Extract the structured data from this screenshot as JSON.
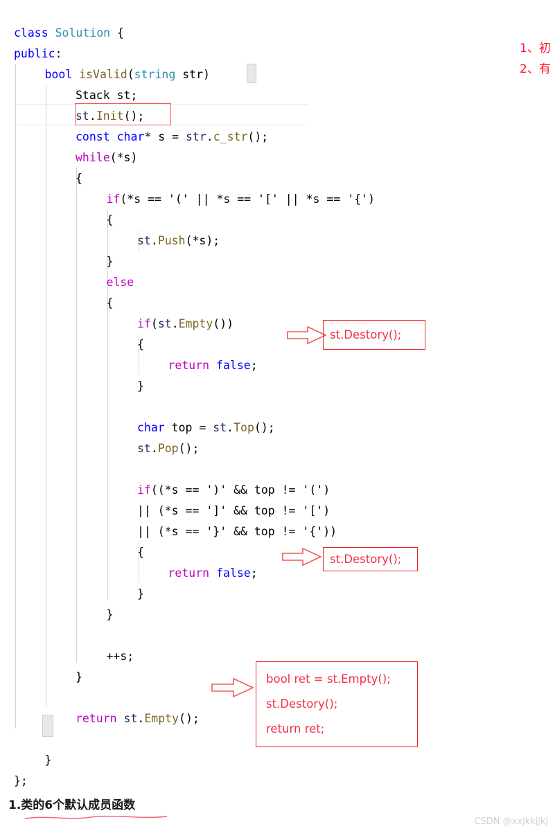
{
  "editor": {
    "language": "cpp",
    "background": "#ffffff",
    "current_line_number": 5,
    "colors": {
      "keyword": "#0000ff",
      "control": "#c000c0",
      "type": "#2b91af",
      "identifier": "#1f2d5e",
      "function": "#7a6420",
      "plain": "#000000",
      "annotation_red": "#f0304a",
      "box_red": "#ee2222"
    },
    "lines": [
      {
        "indent": 0,
        "tokens": [
          {
            "t": "class",
            "c": "kw"
          },
          {
            "t": " ",
            "c": "punc"
          },
          {
            "t": "Solution",
            "c": "type"
          },
          {
            "t": " {",
            "c": "punc"
          }
        ]
      },
      {
        "indent": 0,
        "tokens": [
          {
            "t": "public",
            "c": "kw"
          },
          {
            "t": ":",
            "c": "punc"
          }
        ]
      },
      {
        "indent": 1,
        "tokens": [
          {
            "t": "bool",
            "c": "kw"
          },
          {
            "t": " ",
            "c": "punc"
          },
          {
            "t": "isValid",
            "c": "fn"
          },
          {
            "t": "(",
            "c": "punc"
          },
          {
            "t": "string",
            "c": "type"
          },
          {
            "t": " str) ",
            "c": "punc"
          }
        ]
      },
      {
        "indent": 2,
        "tokens": [
          {
            "t": "Stack st;",
            "c": "punc"
          }
        ]
      },
      {
        "indent": 2,
        "tokens": [
          {
            "t": "st",
            "c": "ident"
          },
          {
            "t": ".",
            "c": "punc"
          },
          {
            "t": "Init",
            "c": "fn"
          },
          {
            "t": "();",
            "c": "punc"
          }
        ]
      },
      {
        "indent": 2,
        "tokens": [
          {
            "t": "const",
            "c": "kw"
          },
          {
            "t": " ",
            "c": "punc"
          },
          {
            "t": "char",
            "c": "kw"
          },
          {
            "t": "* s = ",
            "c": "punc"
          },
          {
            "t": "str",
            "c": "ident"
          },
          {
            "t": ".",
            "c": "punc"
          },
          {
            "t": "c_str",
            "c": "fn"
          },
          {
            "t": "();",
            "c": "punc"
          }
        ]
      },
      {
        "indent": 2,
        "tokens": [
          {
            "t": "while",
            "c": "ctl"
          },
          {
            "t": "(*s)",
            "c": "punc"
          }
        ]
      },
      {
        "indent": 2,
        "tokens": [
          {
            "t": "{",
            "c": "punc"
          }
        ]
      },
      {
        "indent": 3,
        "tokens": [
          {
            "t": "if",
            "c": "ctl"
          },
          {
            "t": "(*s == '(' || *s == '[' || *s == '{')",
            "c": "punc"
          }
        ]
      },
      {
        "indent": 3,
        "tokens": [
          {
            "t": "{",
            "c": "punc"
          }
        ]
      },
      {
        "indent": 4,
        "tokens": [
          {
            "t": "st",
            "c": "ident"
          },
          {
            "t": ".",
            "c": "punc"
          },
          {
            "t": "Push",
            "c": "fn"
          },
          {
            "t": "(*s);",
            "c": "punc"
          }
        ]
      },
      {
        "indent": 3,
        "tokens": [
          {
            "t": "}",
            "c": "punc"
          }
        ]
      },
      {
        "indent": 3,
        "tokens": [
          {
            "t": "else",
            "c": "ctl"
          }
        ]
      },
      {
        "indent": 3,
        "tokens": [
          {
            "t": "{",
            "c": "punc"
          }
        ]
      },
      {
        "indent": 4,
        "tokens": [
          {
            "t": "if",
            "c": "ctl"
          },
          {
            "t": "(",
            "c": "punc"
          },
          {
            "t": "st",
            "c": "ident"
          },
          {
            "t": ".",
            "c": "punc"
          },
          {
            "t": "Empty",
            "c": "fn"
          },
          {
            "t": "())",
            "c": "punc"
          }
        ]
      },
      {
        "indent": 4,
        "tokens": [
          {
            "t": "{",
            "c": "punc"
          }
        ]
      },
      {
        "indent": 5,
        "tokens": [
          {
            "t": "return",
            "c": "ctl"
          },
          {
            "t": " ",
            "c": "punc"
          },
          {
            "t": "false",
            "c": "kw"
          },
          {
            "t": ";",
            "c": "punc"
          }
        ]
      },
      {
        "indent": 4,
        "tokens": [
          {
            "t": "}",
            "c": "punc"
          }
        ]
      },
      {
        "indent": 0,
        "tokens": []
      },
      {
        "indent": 4,
        "tokens": [
          {
            "t": "char",
            "c": "kw"
          },
          {
            "t": " top = ",
            "c": "punc"
          },
          {
            "t": "st",
            "c": "ident"
          },
          {
            "t": ".",
            "c": "punc"
          },
          {
            "t": "Top",
            "c": "fn"
          },
          {
            "t": "();",
            "c": "punc"
          }
        ]
      },
      {
        "indent": 4,
        "tokens": [
          {
            "t": "st",
            "c": "ident"
          },
          {
            "t": ".",
            "c": "punc"
          },
          {
            "t": "Pop",
            "c": "fn"
          },
          {
            "t": "();",
            "c": "punc"
          }
        ]
      },
      {
        "indent": 0,
        "tokens": []
      },
      {
        "indent": 4,
        "tokens": [
          {
            "t": "if",
            "c": "ctl"
          },
          {
            "t": "((*s == ')' && top != '(')",
            "c": "punc"
          }
        ]
      },
      {
        "indent": 4,
        "tokens": [
          {
            "t": "|| (*s == ']' && top != '[')",
            "c": "punc"
          }
        ]
      },
      {
        "indent": 4,
        "tokens": [
          {
            "t": "|| (*s == '}' && top != '{'))",
            "c": "punc"
          }
        ]
      },
      {
        "indent": 4,
        "tokens": [
          {
            "t": "{",
            "c": "punc"
          }
        ]
      },
      {
        "indent": 5,
        "tokens": [
          {
            "t": "return",
            "c": "ctl"
          },
          {
            "t": " ",
            "c": "punc"
          },
          {
            "t": "false",
            "c": "kw"
          },
          {
            "t": ";",
            "c": "punc"
          }
        ]
      },
      {
        "indent": 4,
        "tokens": [
          {
            "t": "}",
            "c": "punc"
          }
        ]
      },
      {
        "indent": 3,
        "tokens": [
          {
            "t": "}",
            "c": "punc"
          }
        ]
      },
      {
        "indent": 0,
        "tokens": []
      },
      {
        "indent": 3,
        "tokens": [
          {
            "t": "++s;",
            "c": "punc"
          }
        ]
      },
      {
        "indent": 2,
        "tokens": [
          {
            "t": "}",
            "c": "punc"
          }
        ]
      },
      {
        "indent": 0,
        "tokens": []
      },
      {
        "indent": 2,
        "tokens": [
          {
            "t": "return",
            "c": "ctl"
          },
          {
            "t": " ",
            "c": "punc"
          },
          {
            "t": "st",
            "c": "ident"
          },
          {
            "t": ".",
            "c": "punc"
          },
          {
            "t": "Empty",
            "c": "fn"
          },
          {
            "t": "();",
            "c": "punc"
          }
        ]
      },
      {
        "indent": 0,
        "tokens": []
      },
      {
        "indent": 1,
        "tokens": [
          {
            "t": "}",
            "c": "punc"
          }
        ]
      },
      {
        "indent": 0,
        "tokens": [
          {
            "t": "};",
            "c": "punc"
          }
        ]
      }
    ]
  },
  "annotations": {
    "note1": "st.Destory();",
    "note2": "st.Destory();",
    "note3_lines": [
      "bool ret = st.Empty();",
      "st.Destory();",
      "return ret;"
    ],
    "top_notes": [
      "1、初",
      "2、有"
    ]
  },
  "heading": {
    "text": "1.类的6个默认成员函数"
  },
  "watermark": {
    "text": "CSDN @xxjkkjjkj"
  }
}
